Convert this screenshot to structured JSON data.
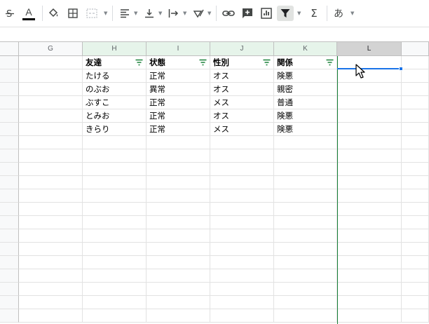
{
  "toolbar": {
    "text_color_letter": "A",
    "input_tools_label": "あ",
    "sum_symbol": "Σ",
    "text_color_bar": "#000000"
  },
  "columns": [
    {
      "letter": "G"
    },
    {
      "letter": "H"
    },
    {
      "letter": "I"
    },
    {
      "letter": "J"
    },
    {
      "letter": "K"
    },
    {
      "letter": "L"
    }
  ],
  "table": {
    "headers": [
      "友達",
      "状態",
      "性別",
      "関係"
    ],
    "rows": [
      [
        "たける",
        "正常",
        "オス",
        "険悪"
      ],
      [
        "のぶお",
        "異常",
        "オス",
        "親密"
      ],
      [
        "ぶすこ",
        "正常",
        "メス",
        "普通"
      ],
      [
        "とみお",
        "正常",
        "オス",
        "険悪"
      ],
      [
        "きらり",
        "正常",
        "メス",
        "険悪"
      ]
    ]
  },
  "colors": {
    "filter_header_bg": "#e6f4ea",
    "filter_accent": "#188038",
    "selection": "#1a73e8"
  }
}
